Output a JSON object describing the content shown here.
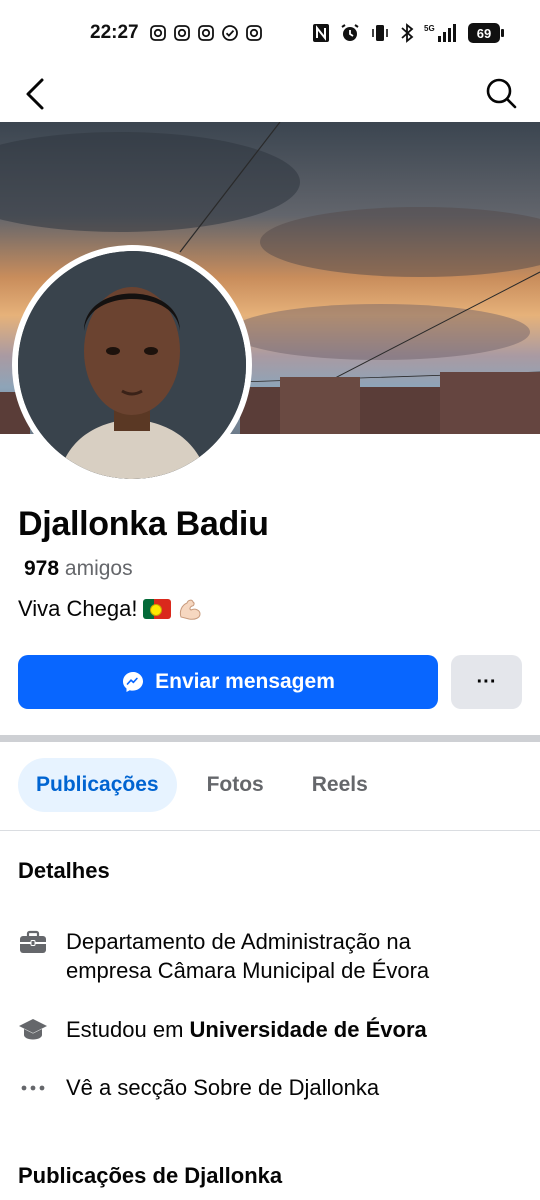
{
  "status_bar": {
    "time": "22:27",
    "battery": "69",
    "network": "5G"
  },
  "profile": {
    "name": "Djallonka Badiu",
    "friends_count": "978",
    "friends_label": "amigos",
    "bio_text": "Viva Chega!"
  },
  "actions": {
    "message_label": "Enviar mensagem",
    "more_label": "···"
  },
  "tabs": [
    {
      "label": "Publicações",
      "active": true
    },
    {
      "label": "Fotos",
      "active": false
    },
    {
      "label": "Reels",
      "active": false
    }
  ],
  "details": {
    "title": "Detalhes",
    "work_line1": "Departamento de Administração na",
    "work_line2": "empresa Câmara Municipal de Évora",
    "education_prefix": "Estudou em",
    "education_school": "Universidade de Évora",
    "about_link": "Vê a secção Sobre de Djallonka"
  },
  "posts": {
    "title": "Publicações de Djallonka"
  },
  "colors": {
    "primary": "#0866ff",
    "tab_active_bg": "#e7f3ff",
    "tab_active_text": "#0064d1",
    "secondary_text": "#65676b"
  },
  "icons": [
    "instagram-icon",
    "check-icon",
    "nfc-icon",
    "alarm-icon",
    "vibrate-icon",
    "bluetooth-icon",
    "signal-icon",
    "battery-icon",
    "back-arrow-icon",
    "search-icon",
    "messenger-icon",
    "briefcase-icon",
    "graduation-cap-icon",
    "more-dots-icon"
  ]
}
